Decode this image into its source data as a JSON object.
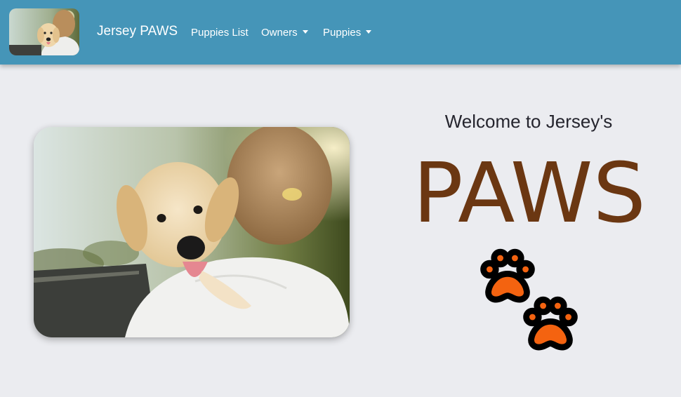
{
  "navbar": {
    "brand": "Jersey PAWS",
    "links": [
      {
        "label": "Puppies List"
      },
      {
        "label": "Owners"
      },
      {
        "label": "Puppies"
      }
    ]
  },
  "hero": {
    "welcome": "Welcome to Jersey's",
    "title": "PAWS"
  },
  "colors": {
    "navbar": "#4595b8",
    "background": "#ebecf0",
    "paws_title": "#6b3712",
    "paw_fill": "#f46310"
  },
  "icons": [
    "paw-print-icon",
    "caret-down-icon"
  ]
}
